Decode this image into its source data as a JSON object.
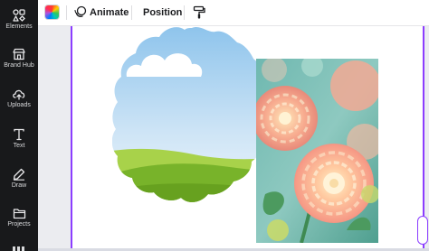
{
  "sidebar": {
    "items": [
      {
        "label": "Elements",
        "icon": "elements-icon"
      },
      {
        "label": "Brand Hub",
        "icon": "brand-hub-icon"
      },
      {
        "label": "Uploads",
        "icon": "uploads-icon"
      },
      {
        "label": "Text",
        "icon": "text-icon"
      },
      {
        "label": "Draw",
        "icon": "draw-icon"
      },
      {
        "label": "Projects",
        "icon": "projects-icon"
      }
    ]
  },
  "toolbar": {
    "color_picker_icon": "color-picker-icon",
    "animate_label": "Animate",
    "animate_icon": "animate-icon",
    "position_label": "Position",
    "paint_icon": "paint-roller-icon"
  },
  "canvas": {
    "frame_image": "scalloped-sky-landscape-frame",
    "photo": "pink-dahlia-flowers-photo",
    "colors": {
      "selection": "#8b3dff",
      "sky_top": "#8ec4ec",
      "sky_bottom": "#e6f2fb",
      "grass_light": "#9acb3c",
      "grass_dark": "#6aa320"
    }
  }
}
